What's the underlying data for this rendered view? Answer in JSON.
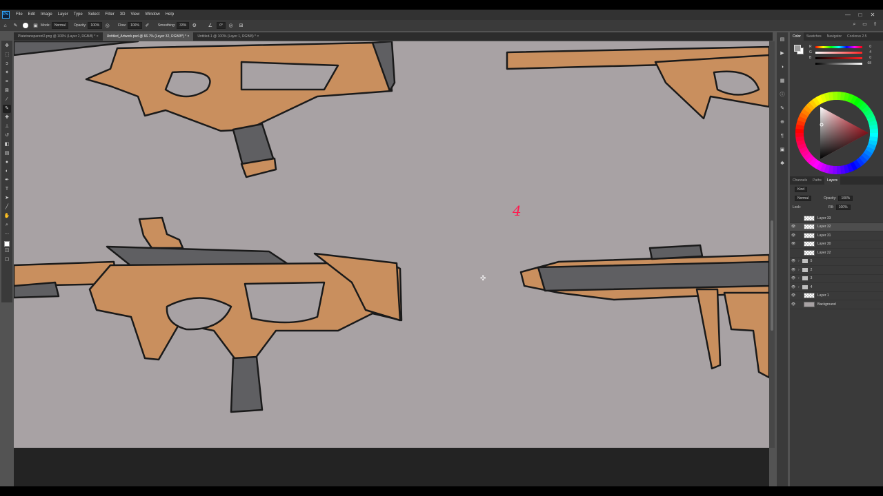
{
  "menubar": {
    "app_icon": "Ps",
    "items": [
      "File",
      "Edit",
      "Image",
      "Layer",
      "Type",
      "Select",
      "Filter",
      "3D",
      "View",
      "Window",
      "Help"
    ],
    "window_controls": [
      "—",
      "□",
      "✕"
    ]
  },
  "options": {
    "mode_label": "Mode:",
    "mode_value": "Normal",
    "opacity_label": "Opacity:",
    "opacity_value": "100%",
    "flow_label": "Flow:",
    "flow_value": "100%",
    "smoothing_label": "Smoothing:",
    "smoothing_value": "33%",
    "angle_value": "0°"
  },
  "tabs": [
    {
      "label": "Platetransparent2.png @ 100% (Layer 2, RGB/8) *",
      "close": "×"
    },
    {
      "label": "Untitled_Artwork.psd @ 66.7% (Layer 32, RGB/8*) *",
      "close": "×"
    },
    {
      "label": "Untitled-1 @ 100% (Layer 1, RGB/8) *",
      "close": "×"
    }
  ],
  "canvas": {
    "annotation_mark": "4",
    "colors": {
      "background": "#a8a2a4",
      "tan": "#c98f5e",
      "dark_gray": "#5f5f62",
      "outline": "#1a1a1a"
    }
  },
  "panels": {
    "color_tabs": [
      "Color",
      "Swatches",
      "Navigator",
      "Coolorus 2.5"
    ],
    "sliders": [
      {
        "label": "R",
        "value": "0"
      },
      {
        "label": "G",
        "value": "4"
      },
      {
        "label": "B",
        "value": "0"
      },
      {
        "label": "",
        "value": "68"
      }
    ],
    "layer_tabs": [
      "Channels",
      "Paths",
      "Layers"
    ],
    "kind_label": "Kind",
    "blend_mode": "Normal",
    "opacity_label": "Opacity:",
    "opacity_value": "100%",
    "lock_label": "Lock:",
    "fill_label": "Fill:",
    "fill_value": "100%",
    "layers": [
      {
        "name": "Layer 33",
        "type": "layer",
        "visible": false,
        "selected": false
      },
      {
        "name": "Layer 32",
        "type": "layer",
        "visible": true,
        "selected": true
      },
      {
        "name": "Layer 31",
        "type": "layer",
        "visible": true,
        "selected": false
      },
      {
        "name": "Layer 30",
        "type": "layer",
        "visible": true,
        "selected": false
      },
      {
        "name": "Layer 22",
        "type": "layer",
        "visible": false,
        "selected": false
      },
      {
        "name": "5",
        "type": "group",
        "visible": true,
        "selected": false
      },
      {
        "name": "2",
        "type": "group",
        "visible": true,
        "selected": false
      },
      {
        "name": "3",
        "type": "group",
        "visible": true,
        "selected": false
      },
      {
        "name": "4",
        "type": "group",
        "visible": true,
        "selected": false
      },
      {
        "name": "Layer 1",
        "type": "layer",
        "visible": true,
        "selected": false
      },
      {
        "name": "Background",
        "type": "background",
        "visible": true,
        "selected": false
      }
    ]
  }
}
